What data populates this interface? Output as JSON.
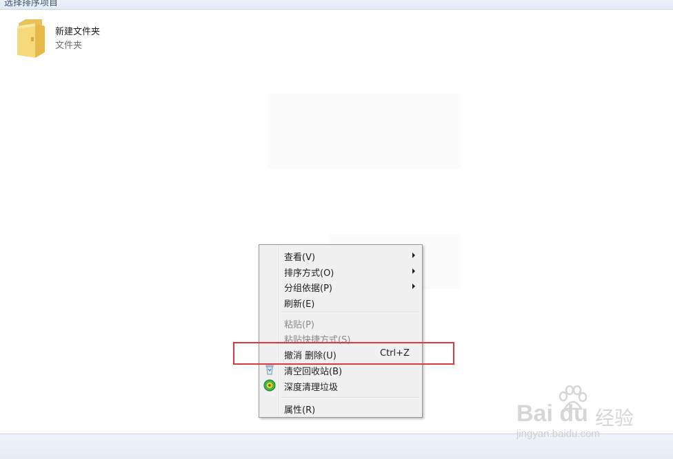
{
  "top_bar": {
    "text": "选择排序项目"
  },
  "folder": {
    "name": "新建文件夹",
    "type": "文件夹",
    "icon": "folder-icon"
  },
  "context_menu": {
    "items": [
      {
        "label": "查看(V)",
        "has_submenu": true
      },
      {
        "label": "排序方式(O)",
        "has_submenu": true
      },
      {
        "label": "分组依据(P)",
        "has_submenu": true
      },
      {
        "label": "刷新(E)"
      },
      {
        "label": "粘贴(P)",
        "disabled": true
      },
      {
        "label": "粘贴快捷方式(S)",
        "disabled": true
      },
      {
        "label": "撤消 删除(U)",
        "shortcut": "Ctrl+Z"
      },
      {
        "label": "清空回收站(B)",
        "icon": "recycle-bin-icon"
      },
      {
        "label": "深度清理垃圾",
        "icon": "deep-clean-icon"
      },
      {
        "label": "属性(R)"
      }
    ]
  },
  "highlight": {
    "color": "#d9383d"
  },
  "watermark": {
    "logo": "Bai du",
    "logo_cn": "经验",
    "url": "jingyan.baidu.com"
  }
}
